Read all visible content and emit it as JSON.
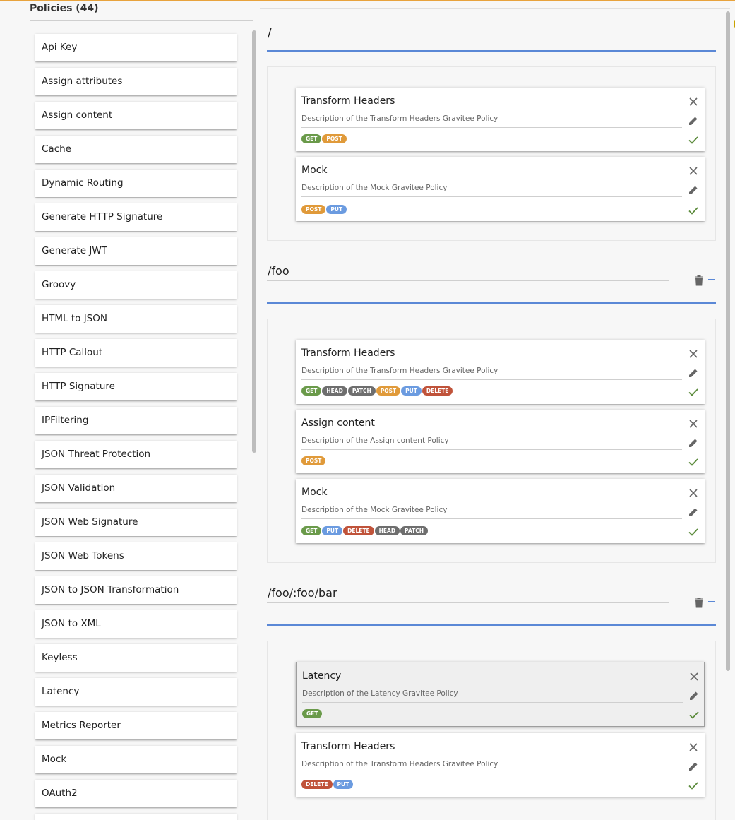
{
  "policies": {
    "title": "Policies (44)",
    "items": [
      "Api Key",
      "Assign attributes",
      "Assign content",
      "Cache",
      "Dynamic Routing",
      "Generate HTTP Signature",
      "Generate JWT",
      "Groovy",
      "HTML to JSON",
      "HTTP Callout",
      "HTTP Signature",
      "IPFiltering",
      "JSON Threat Protection",
      "JSON Validation",
      "JSON Web Signature",
      "JSON Web Tokens",
      "JSON to JSON Transformation",
      "JSON to XML",
      "Keyless",
      "Latency",
      "Metrics Reporter",
      "Mock",
      "OAuth2",
      ""
    ]
  },
  "paths": [
    {
      "label": "/",
      "flows": [
        {
          "title": "Transform Headers",
          "description": "Description of the Transform Headers Gravitee Policy",
          "methods": [
            "GET",
            "POST"
          ]
        },
        {
          "title": "Mock",
          "description": "Description of the Mock Gravitee Policy",
          "methods": [
            "POST",
            "PUT"
          ]
        }
      ]
    },
    {
      "label": "/foo",
      "flows": [
        {
          "title": "Transform Headers",
          "description": "Description of the Transform Headers Gravitee Policy",
          "methods": [
            "GET",
            "HEAD",
            "PATCH",
            "POST",
            "PUT",
            "DELETE"
          ]
        },
        {
          "title": "Assign content",
          "description": "Description of the Assign content Policy",
          "methods": [
            "POST"
          ]
        },
        {
          "title": "Mock",
          "description": "Description of the Mock Gravitee Policy",
          "methods": [
            "GET",
            "PUT",
            "DELETE",
            "HEAD",
            "PATCH"
          ]
        }
      ]
    },
    {
      "label": "/foo/:foo/bar",
      "flows": [
        {
          "title": "Latency",
          "description": "Description of the Latency Gravitee Policy",
          "methods": [
            "GET"
          ],
          "selected": true
        },
        {
          "title": "Transform Headers",
          "description": "Description of the Transform Headers Gravitee Policy",
          "methods": [
            "DELETE",
            "PUT"
          ]
        }
      ]
    }
  ],
  "icons": {
    "close": "close-icon",
    "edit": "pencil-icon",
    "enabled": "check-icon",
    "delete_path": "trash-icon",
    "collapse": "minus-icon"
  },
  "colors": {
    "accent": "#5b88d6",
    "get": "#6a9a4a",
    "post": "#e09a3a",
    "put": "#6b9be0",
    "head": "#6e6e6e",
    "patch": "#6e6e6e",
    "delete": "#c0533a",
    "check": "#5a8a3a"
  }
}
